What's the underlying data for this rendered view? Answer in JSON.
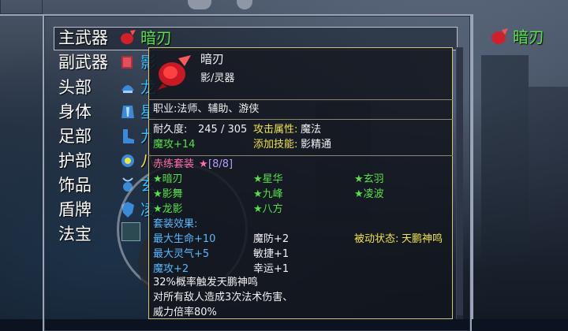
{
  "slots": [
    {
      "label": "主武器",
      "name": "暗刃",
      "color": "#56e04a"
    },
    {
      "label": "副武器",
      "name": "影",
      "color": "#2ec0ff"
    },
    {
      "label": "头部",
      "name": "龙",
      "color": "#2ec0ff"
    },
    {
      "label": "身体",
      "name": "星",
      "color": "#2ec0ff"
    },
    {
      "label": "足部",
      "name": "九",
      "color": "#2ec0ff"
    },
    {
      "label": "护部",
      "name": "八",
      "color": "#f0e24a"
    },
    {
      "label": "饰品",
      "name": "玄",
      "color": "#2ec0ff"
    },
    {
      "label": "盾牌",
      "name": "凌",
      "color": "#2ec0ff"
    },
    {
      "label": "法宝",
      "name": "",
      "color": "#2ec0ff"
    }
  ],
  "right_panel": {
    "item_name": "暗刃"
  },
  "tooltip": {
    "item_name": "暗刃",
    "item_type": "影/灵器",
    "classes": "职业:法师、辅助、游侠",
    "durability_label": "耐久度:",
    "durability_value": "245 / 305",
    "attack_attr_label": "攻击属性:",
    "attack_attr_value": "魔法",
    "magic_attack": "魔攻+14",
    "skill_label": "添加技能:",
    "skill_value": "影精通",
    "set_name": "赤练套装",
    "set_star": "★",
    "set_count": "[8/8]",
    "set_items": [
      "★暗刃",
      "★星华",
      "★玄羽",
      "★影舞",
      "★九峰",
      "★凌波",
      "★龙影",
      "★八方"
    ],
    "set_effect_title": "套装效果:",
    "set_effects": [
      "最大生命+10",
      "魔防+2",
      "最大灵气+5",
      "敏捷+1",
      "魔攻+2",
      "幸运+1"
    ],
    "passive_label": "被动状态:",
    "passive_value": "天鹏神鸣",
    "desc_lines": [
      "32%概率触发天鹏神鸣",
      "对所有敌人造成3次法术伤害、",
      "威力倍率80%"
    ]
  }
}
